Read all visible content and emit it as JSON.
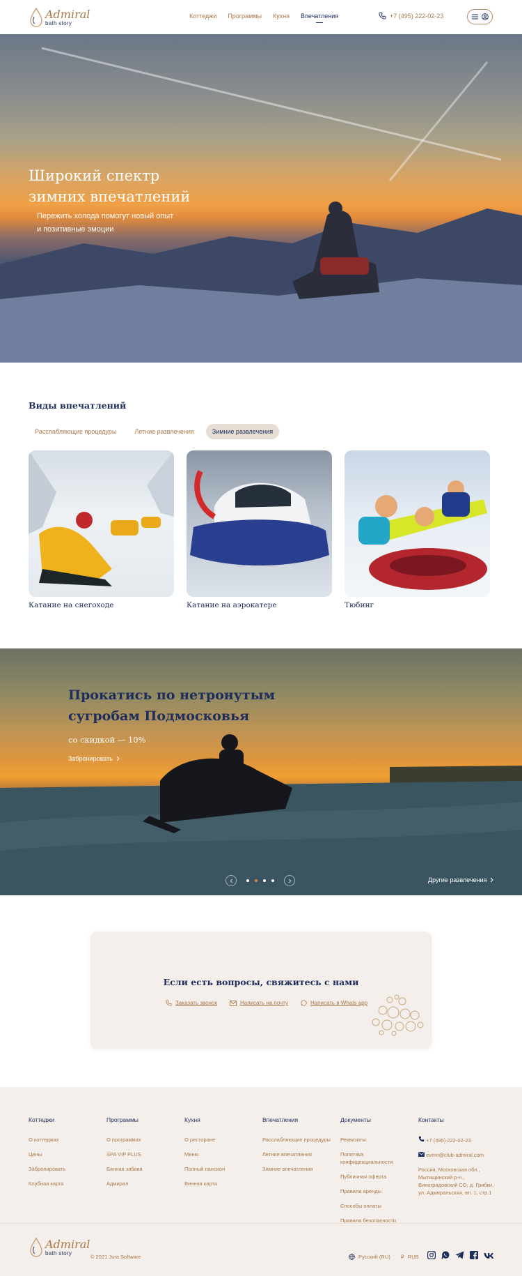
{
  "brand": {
    "name": "Admiral",
    "tagline": "bath story"
  },
  "nav": [
    {
      "label": "Коттеджи"
    },
    {
      "label": "Программы"
    },
    {
      "label": "Кухня"
    },
    {
      "label": "Впечатления",
      "active": true
    }
  ],
  "header": {
    "phone": "+7 (495) 222-02-23"
  },
  "hero": {
    "title_line1": "Широкий спектр",
    "title_line2": "зимних впечатлений",
    "subtitle_line1": "Пережить холода помогут новый опыт",
    "subtitle_line2": "и позитивные эмоции"
  },
  "kinds": {
    "title": "Виды впечатлений",
    "tabs": [
      {
        "label": "Расслабляющие процедуры"
      },
      {
        "label": "Летние развлечения"
      },
      {
        "label": "Зимние развлечения",
        "selected": true
      }
    ],
    "cards": [
      {
        "title": "Катание на снегоходе"
      },
      {
        "title": "Катание на аэрокатере"
      },
      {
        "title": "Тюбинг"
      }
    ]
  },
  "banner": {
    "title_line1": "Прокатись по нетронутым",
    "title_line2": "сугробам Подмосковья",
    "subtitle": "со скидкой — 10%",
    "link": "Забронировать",
    "other_link": "Другие развлечения"
  },
  "contact": {
    "title": "Если есть вопросы, свяжитесь с нами",
    "call": "Заказать звонок",
    "mail": "Написать на почту",
    "whatsapp": "Написать в Whats app"
  },
  "footer": {
    "cols": [
      {
        "title": "Коттеджи",
        "items": [
          "О коттеджах",
          "Цены",
          "Забронировать",
          "Клубная карта"
        ]
      },
      {
        "title": "Программы",
        "items": [
          "О программах",
          "SPA VIP PLUS",
          "Банная забава",
          "Адмирал"
        ]
      },
      {
        "title": "Кухня",
        "items": [
          "О ресторане",
          "Меню",
          "Полный пансион",
          "Винная карта"
        ]
      },
      {
        "title": "Впечатления",
        "items": [
          "Расслабляющие процедуры",
          "Летние впечатления",
          "Зимние впечатления"
        ]
      },
      {
        "title": "Документы",
        "items": [
          "Реквизиты",
          "Политика конфиденциальности",
          "Публичная оферта",
          "Правила аренды",
          "Способы оплаты",
          "Правила безопасности"
        ]
      }
    ],
    "contacts": {
      "title": "Контакты",
      "phone": "+7 (495) 222-02-23",
      "email": "event@club-admiral.com",
      "address": "Россия, Московская обл., Мытищинский р-н., Виноградовский СО, д. Грибки, ул. Адмиральская, вл. 1, стр.1"
    },
    "copyright": "© 2021 Jura Software",
    "language": "Русский (RU)",
    "currency_symbol": "₽",
    "currency": "RUB",
    "socials": [
      "instagram-icon",
      "whatsapp-icon",
      "telegram-icon",
      "facebook-icon",
      "vk-icon"
    ]
  },
  "colors": {
    "brown": "#a8784a",
    "navy": "#1d2d5c",
    "beige": "#f4efea",
    "tab_selected": "#e6ddd4"
  }
}
